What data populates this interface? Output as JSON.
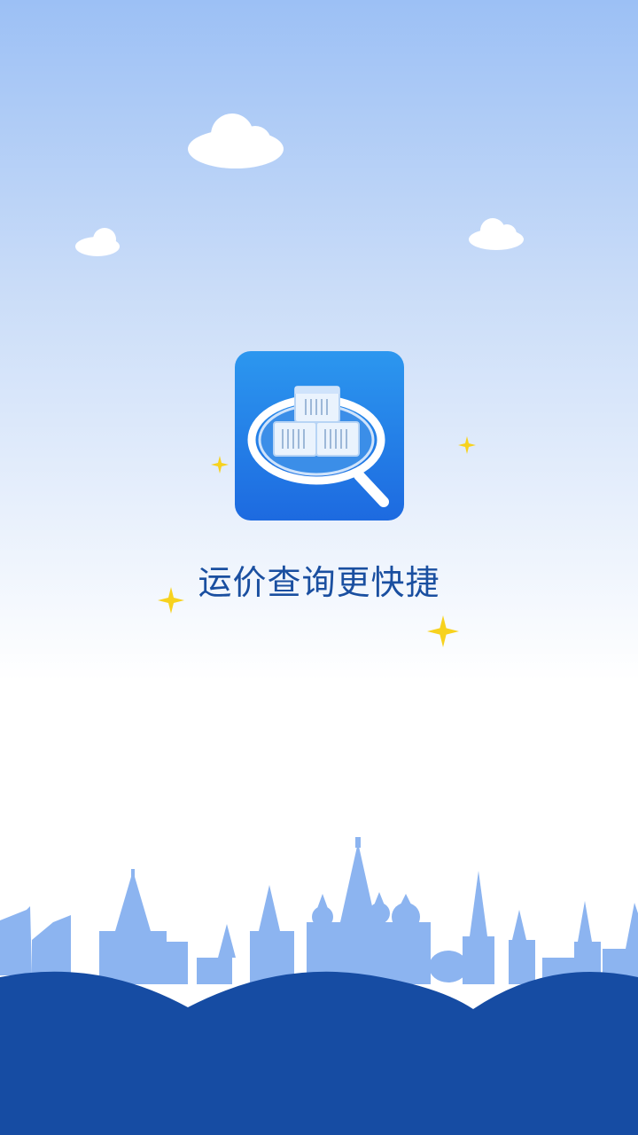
{
  "splash": {
    "tagline": "运价查询更快捷"
  },
  "icons": {
    "app": "container-search-app-icon"
  },
  "colors": {
    "sky_top": "#9cc0f5",
    "tagline": "#1a4fa0",
    "skyline": "#8cb4f0",
    "hills": "#164ca3",
    "sparkle": "#f7d21e"
  }
}
